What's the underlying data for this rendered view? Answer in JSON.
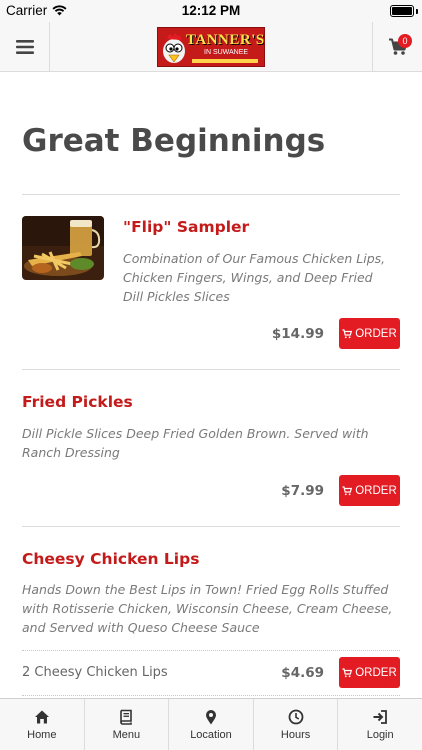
{
  "status_bar": {
    "carrier": "Carrier",
    "time": "12:12 PM"
  },
  "header": {
    "logo_text": "TANNER'S",
    "logo_subtext": "IN SUWANEE",
    "cart_count": "0"
  },
  "page": {
    "title": "Great Beginnings"
  },
  "items": [
    {
      "name": "\"Flip\" Sampler",
      "description": "Combination of Our Famous Chicken Lips, Chicken Fingers, Wings, and Deep Fried Dill Pickles Slices",
      "price": "$14.99",
      "order_label": "ORDER"
    },
    {
      "name": "Fried Pickles",
      "description": "Dill Pickle Slices Deep Fried Golden Brown. Served with Ranch Dressing",
      "price": "$7.99",
      "order_label": "ORDER"
    },
    {
      "name": "Cheesy Chicken Lips",
      "description": "Hands Down the Best Lips in Town! Fried Egg Rolls Stuffed with Rotisserie Chicken, Wisconsin Cheese, Cream Cheese, and Served with Queso Cheese Sauce",
      "variants": [
        {
          "name": "2 Cheesy Chicken Lips",
          "price": "$4.69",
          "order_label": "ORDER"
        }
      ]
    }
  ],
  "bottom_nav": [
    {
      "label": "Home",
      "icon": "home-icon"
    },
    {
      "label": "Menu",
      "icon": "book-icon"
    },
    {
      "label": "Location",
      "icon": "map-marker-icon"
    },
    {
      "label": "Hours",
      "icon": "clock-icon"
    },
    {
      "label": "Login",
      "icon": "sign-in-icon"
    }
  ],
  "colors": {
    "accent": "#e31b23",
    "item_name": "#c41a1a",
    "bar_bg": "#f7f7f7"
  }
}
